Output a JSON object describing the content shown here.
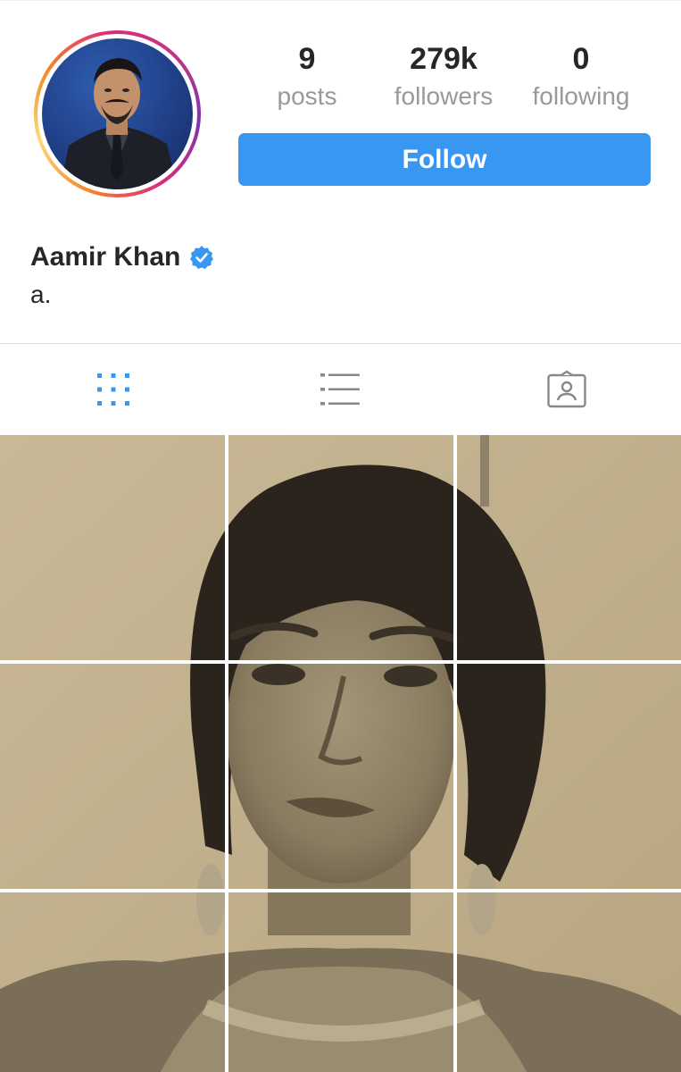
{
  "profile": {
    "name": "Aamir Khan",
    "verified": true,
    "bio": "a.",
    "avatar_icon": "profile-photo"
  },
  "stats": [
    {
      "value": "9",
      "label": "posts"
    },
    {
      "value": "279k",
      "label": "followers"
    },
    {
      "value": "0",
      "label": "following"
    }
  ],
  "follow_button": {
    "label": "Follow"
  },
  "tabs": [
    {
      "name": "grid-view",
      "icon": "grid-icon",
      "active": true
    },
    {
      "name": "list-view",
      "icon": "list-icon",
      "active": false
    },
    {
      "name": "tagged",
      "icon": "tagged-person-icon",
      "active": false
    }
  ],
  "colors": {
    "accent": "#3897f0",
    "text": "#262626",
    "muted": "#999999",
    "verified": "#3897f0"
  },
  "posts_grid": {
    "columns": 3,
    "rows_visible": 3,
    "content": "split sepia portrait photo"
  }
}
